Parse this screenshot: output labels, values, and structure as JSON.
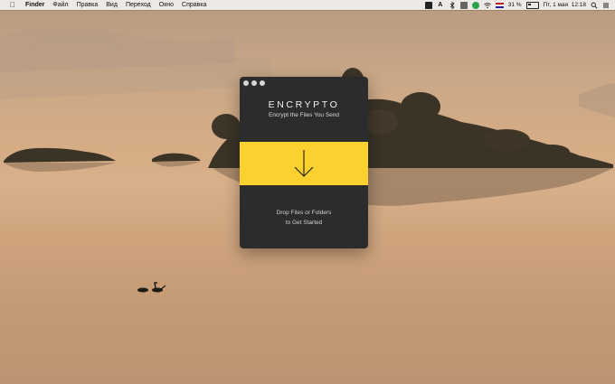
{
  "menubar": {
    "apple_icon": "apple-logo-icon",
    "app_name": "Finder",
    "items": [
      "Файл",
      "Правка",
      "Вид",
      "Переход",
      "Окно",
      "Справка"
    ],
    "status": {
      "battery_percent": "31 %",
      "datetime": "Пт, 1 мая  12:18"
    }
  },
  "window": {
    "title": "ENCRYPTO",
    "subtitle": "Encrypt the Files You Send",
    "drop_line1": "Drop Files or Folders",
    "drop_line2": "to Get Started",
    "accent_color": "#fad12e",
    "background_color": "#2c2c2c"
  }
}
